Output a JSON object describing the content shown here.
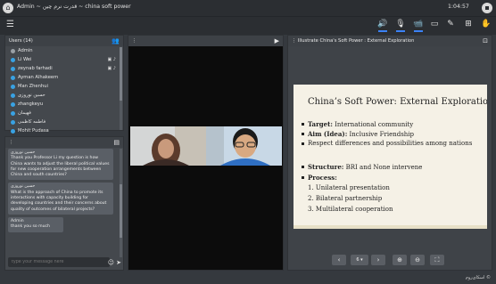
{
  "topbar": {
    "title": "Admin ~ قدرت نرم چین ~ china soft power",
    "clock": "1:04:57"
  },
  "toolbar": {
    "tools": [
      "speaker-icon",
      "mic-icon",
      "camera-icon",
      "screen-icon",
      "pen-icon",
      "add-icon",
      "hand-icon"
    ]
  },
  "users": {
    "header": "Users (14)",
    "list": [
      {
        "name": "Admin"
      },
      {
        "name": "Li Wei"
      },
      {
        "name": "zeynab farhadi"
      },
      {
        "name": "Ayman Alhakeem"
      },
      {
        "name": "Man Zhenhui"
      },
      {
        "name": "حسین نوروزی"
      },
      {
        "name": "zhangkeyu"
      },
      {
        "name": "فهیمان"
      },
      {
        "name": "فاطمه کاظمی"
      },
      {
        "name": "Mohit Pudasa"
      }
    ]
  },
  "chat": {
    "header": "",
    "messages": [
      {
        "who": "حسین نوروزی",
        "text": "Thank you Professor Li my question is how China wants to adjust the liberal political values for new cooperation arrangements between China and south countries?"
      },
      {
        "who": "حسین نوروزی",
        "text": "What is the approach of China to promote its interactions with capacity building for developing countries and their concerns about quality of outcomes of bilateral projects?"
      },
      {
        "who": "Admin",
        "text": "thank you so much"
      }
    ],
    "input_placeholder": "type your message here"
  },
  "presentation": {
    "header": "Illustrate China's Soft Power : External Exploration",
    "slide": {
      "title": "China’s Soft Power: External Exploration",
      "lines": [
        {
          "bold": "Target:",
          "rest": " International community"
        },
        {
          "bold": "Aim (Idea):",
          "rest": " Inclusive Friendship"
        },
        {
          "bold": "",
          "rest": "Respect differences and possibilities among nations"
        },
        {
          "bold": "Structure:",
          "rest": " BRI and None intervene"
        },
        {
          "bold": "Process:",
          "rest": ""
        },
        {
          "bold": "",
          "rest": "1. Unilateral presentation"
        },
        {
          "bold": "",
          "rest": "2. Bilateral partnership"
        },
        {
          "bold": "",
          "rest": "3. Multilateral cooperation"
        }
      ]
    },
    "page": "6"
  },
  "footer": {
    "brand": "اسکای‌روم ©"
  },
  "colors": {
    "accent": "#3b82f6",
    "presence": "#39a2e3",
    "topbar": "#2b2e32",
    "panel": "#44484d"
  }
}
